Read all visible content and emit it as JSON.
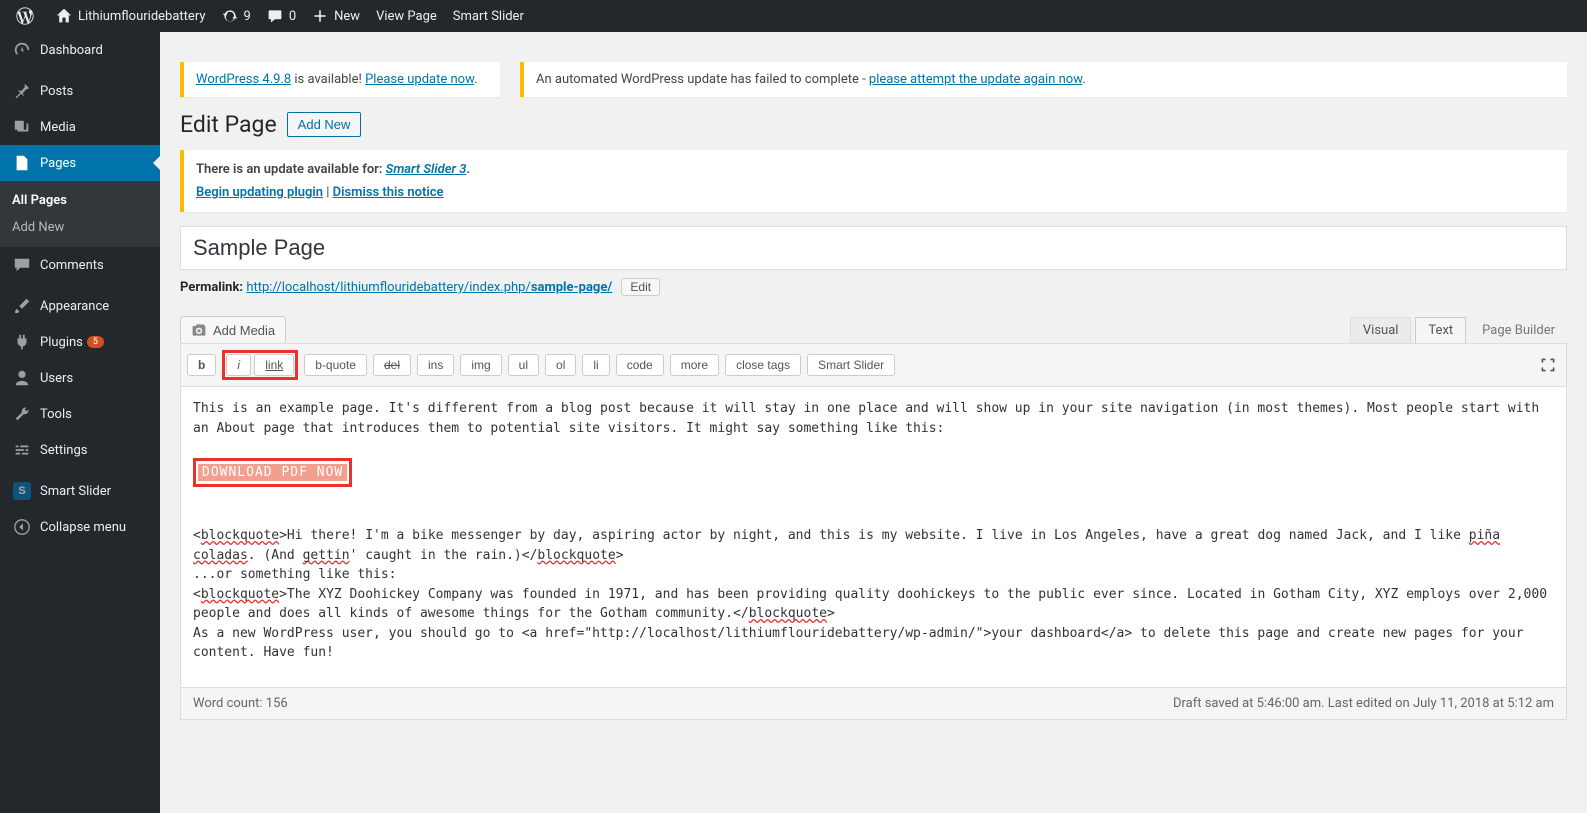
{
  "toolbar": {
    "site_name": "Lithiumflouridebattery",
    "updates_count": "9",
    "comments_count": "0",
    "new_label": "New",
    "view_page": "View Page",
    "smart_slider": "Smart Slider"
  },
  "sidebar": {
    "dashboard": "Dashboard",
    "posts": "Posts",
    "media": "Media",
    "pages": "Pages",
    "pages_sub": {
      "all": "All Pages",
      "add": "Add New"
    },
    "comments": "Comments",
    "appearance": "Appearance",
    "plugins": "Plugins",
    "plugins_badge": "5",
    "users": "Users",
    "tools": "Tools",
    "settings": "Settings",
    "smart_slider": "Smart Slider",
    "collapse": "Collapse menu"
  },
  "notices": {
    "wp_version_link": "WordPress 4.9.8",
    "wp_is_available": " is available! ",
    "wp_update_link": "Please update now",
    "auto_fail_text": "An automated WordPress update has failed to complete - ",
    "auto_fail_link": "please attempt the update again now",
    "update_for_text": "There is an update available for: ",
    "update_for_link": "Smart Slider 3",
    "begin_update_link": "Begin updating plugin",
    "dismiss_sep": " | ",
    "dismiss_link": "Dismiss this notice"
  },
  "heading": {
    "title": "Edit Page",
    "add_new": "Add New"
  },
  "post": {
    "title": "Sample Page",
    "permalink_label": "Permalink:",
    "permalink_base": "http://localhost/lithiumflouridebattery/index.php/",
    "permalink_slug": "sample-page/",
    "edit_btn": "Edit"
  },
  "editor": {
    "add_media": "Add Media",
    "tabs": {
      "visual": "Visual",
      "text": "Text",
      "page_builder": "Page Builder"
    },
    "quicktags": {
      "b": "b",
      "i": "i",
      "link": "link",
      "bquote": "b-quote",
      "del": "del",
      "ins": "ins",
      "img": "img",
      "ul": "ul",
      "ol": "ol",
      "li": "li",
      "code": "code",
      "more": "more",
      "close": "close tags",
      "slider": "Smart Slider"
    },
    "content": {
      "p1": "This is an example page. It's different from a blog post because it will stay in one place and will show up in your site navigation (in most themes). Most people start with an About page that introduces them to potential site visitors. It might say something like this:",
      "download": "DOWNLOAD PDF NOW",
      "bq1_open": "<",
      "bq1_tag": "blockquote",
      "bq1_rest": ">Hi there! I'm a bike messenger by day, aspiring actor by night, and this is my website. I live in Los Angeles, have a great dog named Jack, and I like ",
      "pina": "piña",
      "nl1": " ",
      "coladas": "coladas",
      "bq1_mid": ". (And ",
      "gettin": "gettin",
      "bq1_end1": "' caught in the rain.)</",
      "bq1_tag2": "blockquote",
      "bq1_close": ">",
      "or": "...or something like this:",
      "bq2_open": "<",
      "bq2_tag": "blockquote",
      "bq2_rest": ">The XYZ Doohickey Company was founded in 1971, and has been providing quality doohickeys to the public ever since. Located in Gotham City, XYZ employs over 2,000 people and does all kinds of awesome things for the Gotham community.</",
      "bq2_tag2": "blockquote",
      "bq2_close": ">",
      "p4": "As a new WordPress user, you should go to <a href=\"http://localhost/lithiumflouridebattery/wp-admin/\">your dashboard</a> to delete this page and create new pages for your content. Have fun!"
    },
    "footer": {
      "word_count": "Word count: 156",
      "status": "Draft saved at 5:46:00 am. Last edited on July 11, 2018 at 5:12 am"
    }
  }
}
